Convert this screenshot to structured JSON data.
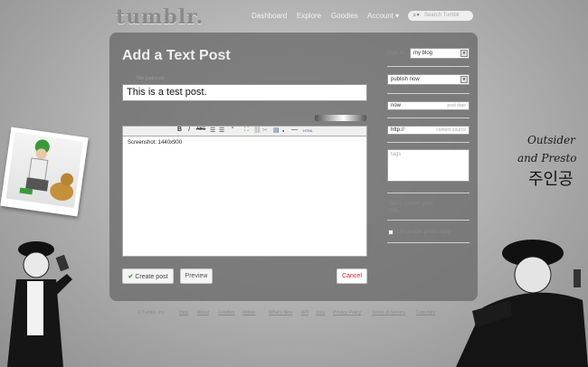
{
  "header": {
    "logo": "tumblr.",
    "nav": [
      "Dashboard",
      "Explore",
      "Goodies",
      "Account ▾"
    ],
    "search_placeholder": "Search Tumblr"
  },
  "post_form": {
    "heading": "Add a Text Post",
    "title_label": "Title (optional)",
    "title_value": "This is a test post.",
    "body_text": "Screenshot: 1440x900",
    "toolbar": [
      "B",
      "I",
      "ABC",
      "☰",
      "☰",
      "“",
      "⛶",
      "⛓",
      "✂",
      "▤",
      "●",
      "―",
      "HTML"
    ],
    "create_label": "Create post",
    "preview_label": "Preview",
    "cancel_label": "Cancel"
  },
  "sidebar": {
    "post_to_label": "Post to",
    "blog_value": "my blog",
    "publish_value": "publish now",
    "date_value": "now",
    "date_hint": "post date",
    "source_value": "http://",
    "source_hint": "content source",
    "tags_placeholder": "tags",
    "url_label": "Set a custom post URL",
    "checkbox_label": "Let people photo reply"
  },
  "footer": {
    "copyright": "© Tumblr, Inc.",
    "links": [
      "Help",
      "About",
      "Goodies",
      "Mobile",
      "What's New",
      "API",
      "Jobs",
      "Privacy Policy",
      "Terms of Service",
      "Copyright"
    ]
  },
  "decor": {
    "script_line1": "Outsider",
    "script_line2": "and Presto",
    "hangul": "주인공"
  },
  "colors": {
    "accent_green": "#3a9a3a",
    "cancel_red": "#cc2233"
  }
}
